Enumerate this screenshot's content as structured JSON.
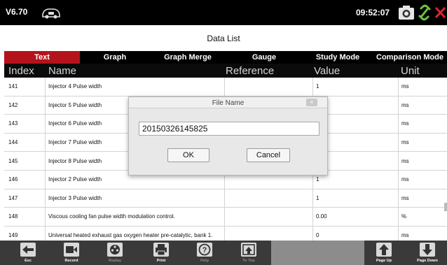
{
  "topbar": {
    "version": "V6.70",
    "time": "09:52:07",
    "icons": [
      "car-logo-icon",
      "camera-icon",
      "link-icon",
      "close-icon"
    ],
    "accent_color": "#b5131c"
  },
  "page": {
    "title": "Data List"
  },
  "tabs": [
    {
      "label": "Text",
      "active": true
    },
    {
      "label": "Graph",
      "active": false
    },
    {
      "label": "Graph Merge",
      "active": false
    },
    {
      "label": "Gauge",
      "active": false
    },
    {
      "label": "Study Mode",
      "active": false
    },
    {
      "label": "Comparison Mode",
      "active": false
    }
  ],
  "table": {
    "columns": [
      "Index",
      "Name",
      "Reference",
      "Value",
      "Unit"
    ],
    "rows": [
      {
        "index": "141",
        "name": "Injector 4  Pulse width",
        "reference": "",
        "value": "1",
        "unit": "ms"
      },
      {
        "index": "142",
        "name": "Injector 5  Pulse width",
        "reference": "",
        "value": "",
        "unit": "ms"
      },
      {
        "index": "143",
        "name": "Injector 6  Pulse width",
        "reference": "",
        "value": "",
        "unit": "ms"
      },
      {
        "index": "144",
        "name": "Injector  7  Pulse width",
        "reference": "",
        "value": "",
        "unit": "ms"
      },
      {
        "index": "145",
        "name": "Injector  8  Pulse width",
        "reference": "",
        "value": "",
        "unit": "ms"
      },
      {
        "index": "146",
        "name": "Injector 2  Pulse width",
        "reference": "",
        "value": "1",
        "unit": "ms"
      },
      {
        "index": "147",
        "name": "Injector 3  Pulse width",
        "reference": "",
        "value": "1",
        "unit": "ms"
      },
      {
        "index": "148",
        "name": "Viscous cooling fan pulse width modulation control.",
        "reference": "",
        "value": "0.00",
        "unit": "%"
      },
      {
        "index": "149",
        "name": "Universal heated exhaust gas oxygen heater pre-catalytic, bank 1.",
        "reference": "",
        "value": "0",
        "unit": "ms"
      }
    ]
  },
  "dialog": {
    "title": "File Name",
    "close_label": "×",
    "input_value": "20150326145825",
    "ok_label": "OK",
    "cancel_label": "Cancel"
  },
  "bottombar": {
    "items": [
      {
        "label": "Esc",
        "icon": "back-arrow-icon",
        "enabled": true
      },
      {
        "label": "Record",
        "icon": "video-camera-icon",
        "enabled": true
      },
      {
        "label": "Replay",
        "icon": "film-reel-icon",
        "enabled": false
      },
      {
        "label": "Print",
        "icon": "printer-icon",
        "enabled": true
      },
      {
        "label": "Help",
        "icon": "help-icon",
        "enabled": false
      },
      {
        "label": "To Top",
        "icon": "to-top-icon",
        "enabled": false
      },
      {
        "label": "Page Up",
        "icon": "arrow-up-icon",
        "enabled": true
      },
      {
        "label": "Page Down",
        "icon": "arrow-down-icon",
        "enabled": true
      }
    ]
  }
}
